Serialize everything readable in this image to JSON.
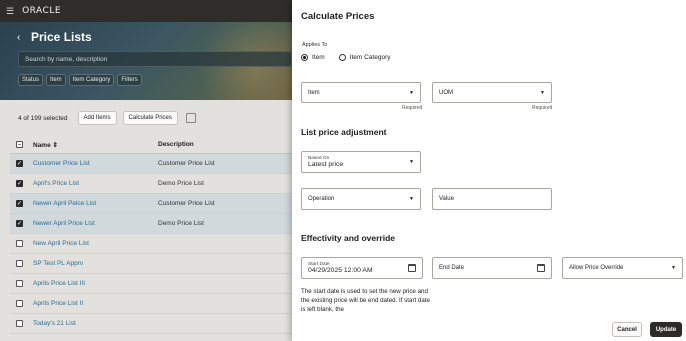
{
  "app": {
    "logo": "ORACLE",
    "menu_icon": "hamburger-icon"
  },
  "list_page": {
    "title": "Price Lists",
    "search_placeholder": "Search by name, description",
    "filter_chips": [
      "Status",
      "Item",
      "Item Category",
      "Filters"
    ],
    "selection_count": "4 of 199 selected",
    "toolbar": {
      "add_items": "Add Items",
      "calculate_prices": "Calculate Prices"
    },
    "columns": {
      "name": "Name",
      "description": "Description"
    },
    "rows": [
      {
        "name": "Customer Price List",
        "description": "Customer Price List",
        "selected": true
      },
      {
        "name": "April's Price List",
        "description": "Demo Price List",
        "selected": true
      },
      {
        "name": "Newer April Peice List",
        "description": "Customer Price List",
        "selected": true
      },
      {
        "name": "Newer April Price List",
        "description": "Demo Price List",
        "selected": true
      },
      {
        "name": "New April Price List",
        "description": "",
        "selected": false
      },
      {
        "name": "SP Test PL Apprv",
        "description": "",
        "selected": false
      },
      {
        "name": "Aprils Price List III",
        "description": "",
        "selected": false
      },
      {
        "name": "Aprils Price List II",
        "description": "",
        "selected": false
      },
      {
        "name": "Today's 21 List",
        "description": "",
        "selected": false
      }
    ]
  },
  "drawer": {
    "title": "Calculate Prices",
    "applies_to_label": "Applies To",
    "applies_to_options": {
      "item": "Item",
      "item_category": "Item Category"
    },
    "applies_to_selected": "Item",
    "item_placeholder": "Item",
    "uom_placeholder": "UOM",
    "required_text": "Required",
    "list_price_section": "List price adjustment",
    "based_on_label": "Based On",
    "based_on_value": "Latest price",
    "operation_placeholder": "Operation",
    "value_placeholder": "Value",
    "effectivity_section": "Effectivity and override",
    "start_date_label": "Start Date",
    "start_date_value": "04/29/2025 12:00 AM",
    "end_date_placeholder": "End Date",
    "allow_override_placeholder": "Allow Price Override",
    "help_text": "The start date is used to set the new price and the existing price will be end dated. If start date is left blank, the",
    "cancel_label": "Cancel",
    "update_label": "Update"
  }
}
